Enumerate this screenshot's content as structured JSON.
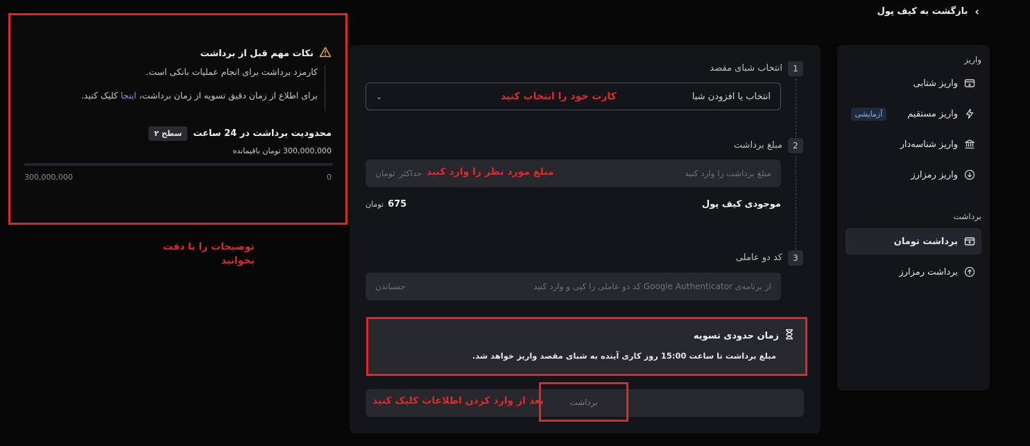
{
  "back": {
    "label": "بازگشت به کیف پول"
  },
  "sidebar": {
    "deposit_title": "واریز",
    "deposit_items": [
      {
        "label": "واریز شتابی",
        "icon": "card-deposit-icon"
      },
      {
        "label": "واریز مستقیم",
        "icon": "lightning-icon",
        "badge": "آزمایشی"
      },
      {
        "label": "واریز شناسه‌دار",
        "icon": "bank-icon"
      },
      {
        "label": "واریز رمزارز",
        "icon": "download-circle-icon"
      }
    ],
    "withdraw_title": "برداشت",
    "withdraw_items": [
      {
        "label": "برداشت تومان",
        "icon": "card-withdraw-icon",
        "active": true
      },
      {
        "label": "برداشت رمزارز",
        "icon": "upload-circle-icon"
      }
    ]
  },
  "form": {
    "step1": {
      "num": "1",
      "label": "انتخاب شبای مقصد",
      "select_value": "انتخاب یا افزودن شبا",
      "annotation": "کارت خود را انتخاب کنید"
    },
    "step2": {
      "num": "2",
      "label": "مبلغ برداشت",
      "placeholder": "مبلغ برداشت را وارد کنید",
      "hint": "حداکثر",
      "unit": "تومان",
      "annotation": "مبلغ مورد نظر را وارد کنید"
    },
    "balance": {
      "label": "موجودی کیف پول",
      "value": "675",
      "unit": "تومان"
    },
    "step3": {
      "num": "3",
      "label": "کد دو عاملی",
      "placeholder": "از برنامه‌ی Google Authenticator کد دو عاملی را کپی و وارد کنید",
      "paste": "جسباندن"
    },
    "settle": {
      "title": "زمان حدودی تسویه",
      "text": "مبلغ برداشت تا ساعت 15:00 روز کاری آینده به شبای مقصد واریز خواهد شد."
    },
    "submit": {
      "label": "برداشت",
      "annotation": "بعد از وارد کردن اطلاعات کلیک کنید"
    }
  },
  "info": {
    "title": "نکات مهم قبل از برداشت",
    "note1": "کارمزد برداشت برای انجام عملیات بانکی است.",
    "note2_prefix": "برای اطلاع از زمان دقیق تسویه از زمان برداشت،",
    "note2_link": "اینجا",
    "note2_suffix": "کلیک کنید.",
    "limit_title": "محدودیت برداشت در 24 ساعت",
    "level": "سطح ۲",
    "remaining": "300,000,000 تومان باقیمانده",
    "progress": 0,
    "scale_min": "0",
    "scale_max": "300,000,000"
  },
  "annotation_read": {
    "line1": "توضیحات را با دقت",
    "line2": "بخوانید"
  }
}
